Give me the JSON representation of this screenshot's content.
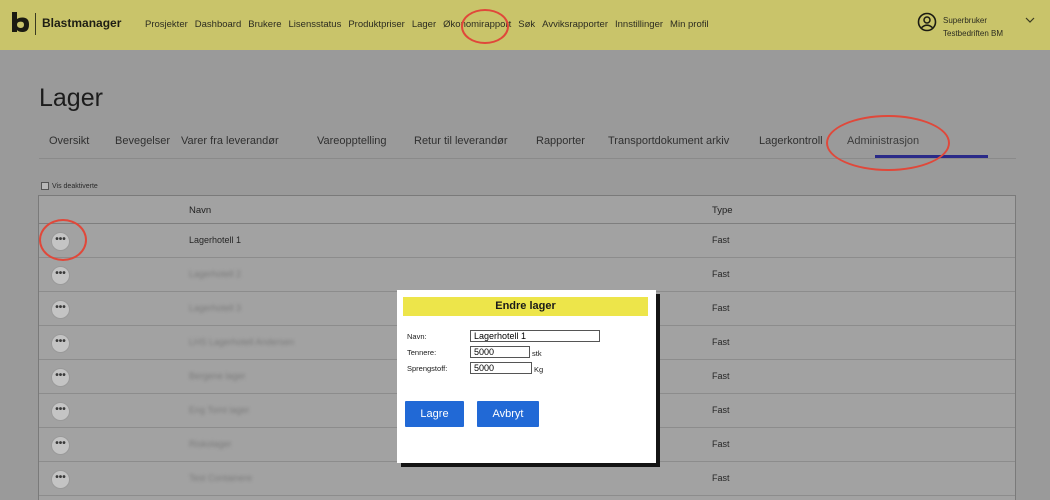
{
  "app": {
    "brand": "Blastmanager"
  },
  "nav": [
    "Prosjekter",
    "Dashboard",
    "Brukere",
    "Lisensstatus",
    "Produktpriser",
    "Lager",
    "Økonomirapport",
    "Søk",
    "Avviksrapporter",
    "Innstillinger",
    "Min profil"
  ],
  "user": {
    "role": "Superbruker",
    "company": "Testbedriften BM"
  },
  "page": {
    "title": "Lager"
  },
  "tabs": [
    "Oversikt",
    "Bevegelser",
    "Varer fra leverandør",
    "Vareopptelling",
    "Retur til leverandør",
    "Rapporter",
    "Transportdokument arkiv",
    "Lagerkontroll",
    "Administrasjon"
  ],
  "active_tab": "Administrasjon",
  "filter": {
    "show_deactivated_label": "Vis deaktiverte"
  },
  "table": {
    "headers": {
      "name": "Navn",
      "type": "Type"
    },
    "row_button_glyph": "•••",
    "rows": [
      {
        "name": "Lagerhotell 1",
        "type": "Fast",
        "blurred": false
      },
      {
        "name": "Lagerhotell 2",
        "type": "Fast",
        "blurred": true
      },
      {
        "name": "Lagerhotell 3",
        "type": "Fast",
        "blurred": true
      },
      {
        "name": "LHS Lagerhotell Andersen",
        "type": "Fast",
        "blurred": true
      },
      {
        "name": "Bergene lager",
        "type": "Fast",
        "blurred": true
      },
      {
        "name": "Eng Tomt lager",
        "type": "Fast",
        "blurred": true
      },
      {
        "name": "Riskolager",
        "type": "Fast",
        "blurred": true
      },
      {
        "name": "Test Containere",
        "type": "Fast",
        "blurred": true
      }
    ]
  },
  "modal": {
    "title": "Endre lager",
    "fields": {
      "name": {
        "label": "Navn:",
        "value": "Lagerhotell 1"
      },
      "detonators": {
        "label": "Tennere:",
        "value": "5000",
        "unit": "stk"
      },
      "explosives": {
        "label": "Sprengstoff:",
        "value": "5000",
        "unit": "Kg"
      }
    },
    "save_label": "Lagre",
    "cancel_label": "Avbryt"
  },
  "icons": {
    "logo": "blastmanager-logo-icon",
    "user": "user-circle-icon",
    "chevron": "chevron-down-icon"
  },
  "colors": {
    "topbar": "#c9c46a",
    "modal_header": "#ede54a",
    "primary_button": "#2169d6",
    "highlight_ring": "#e0483a"
  }
}
